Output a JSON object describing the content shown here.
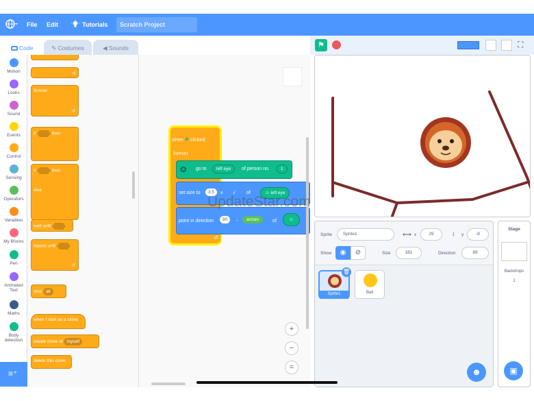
{
  "menubar": {
    "file": "File",
    "edit": "Edit",
    "tutorials": "Tutorials",
    "project_title": "Scratch Project"
  },
  "tabs": {
    "code": "Code",
    "costumes": "Costumes",
    "sounds": "Sounds"
  },
  "categories": [
    {
      "label": "Motion",
      "color": "#4c97ff"
    },
    {
      "label": "Looks",
      "color": "#9966ff"
    },
    {
      "label": "Sound",
      "color": "#cf63cf"
    },
    {
      "label": "Events",
      "color": "#ffd500"
    },
    {
      "label": "Control",
      "color": "#ffab19"
    },
    {
      "label": "Sensing",
      "color": "#5cb1d6"
    },
    {
      "label": "Operators",
      "color": "#59c059"
    },
    {
      "label": "Variables",
      "color": "#ff8c1a"
    },
    {
      "label": "My Blocks",
      "color": "#ff6680"
    },
    {
      "label": "Pen",
      "color": "#0fbd8c"
    },
    {
      "label": "Animated Text",
      "color": "#9966ff"
    },
    {
      "label": "Maths",
      "color": "#3a5a8c"
    },
    {
      "label": "Body detection",
      "color": "#0fbd8c"
    }
  ],
  "palette": {
    "forever": "forever",
    "if": "if",
    "then": "then",
    "if2": "if",
    "then2": "then",
    "else": "else",
    "wait_until": "wait until",
    "repeat_until": "repeat until",
    "stop": "stop",
    "stop_opt": "all",
    "when_clone": "when I start as a clone",
    "create_clone": "create clone of",
    "create_clone_opt": "myself",
    "delete_clone": "delete this clone"
  },
  "script": {
    "when_clicked": "when",
    "clicked": "clicked",
    "forever": "forever",
    "go_to": "go to",
    "left_eye": "left eye",
    "of_person": "of person no.",
    "person_no": "1",
    "set_size": "set size to",
    "size_val": "3.5",
    "x": "x",
    "sqrt": "√",
    "of": "of",
    "left_eye2": "left eye",
    "point_dir": "point in direction",
    "dir_val": "90",
    "minus": "-",
    "arctan": "arctan",
    "of2": "of"
  },
  "watermark": "UpdateStar.com",
  "sprite_info": {
    "sprite_label": "Sprite",
    "sprite_name": "Sprite1",
    "x_label": "x",
    "x_val": "29",
    "y_label": "y",
    "y_val": "-8",
    "show_label": "Show",
    "size_label": "Size",
    "size_val": "181",
    "direction_label": "Direction",
    "direction_val": "89"
  },
  "sprites": [
    {
      "name": "Sprite1"
    },
    {
      "name": "Ball"
    }
  ],
  "stage_panel": {
    "title": "Stage",
    "backdrops_label": "Backdrops",
    "backdrops_count": "1"
  },
  "zoom_controls": {
    "zoom_in": "+",
    "zoom_out": "−",
    "reset": "="
  }
}
